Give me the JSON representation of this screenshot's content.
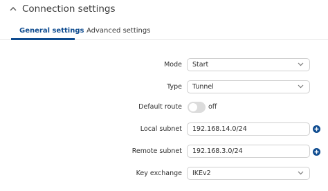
{
  "section": {
    "title": "Connection settings",
    "collapse_icon": "chevron-up-icon"
  },
  "tabs": [
    {
      "label": "General settings",
      "active": true
    },
    {
      "label": "Advanced settings",
      "active": false
    }
  ],
  "form": {
    "mode": {
      "label": "Mode",
      "value": "Start"
    },
    "type": {
      "label": "Type",
      "value": "Tunnel"
    },
    "default_route": {
      "label": "Default route",
      "state_text": "off",
      "enabled": false
    },
    "local_subnet": {
      "label": "Local subnet",
      "value": "192.168.14.0/24",
      "add_icon": "plus-circle-icon"
    },
    "remote_subnet": {
      "label": "Remote subnet",
      "value": "192.168.3.0/24",
      "add_icon": "plus-circle-icon"
    },
    "key_exchange": {
      "label": "Key exchange",
      "value": "IKEv2"
    }
  },
  "colors": {
    "accent": "#0e4b8f",
    "border": "#cfcfcf",
    "toggle_off": "#dcdcdc"
  }
}
